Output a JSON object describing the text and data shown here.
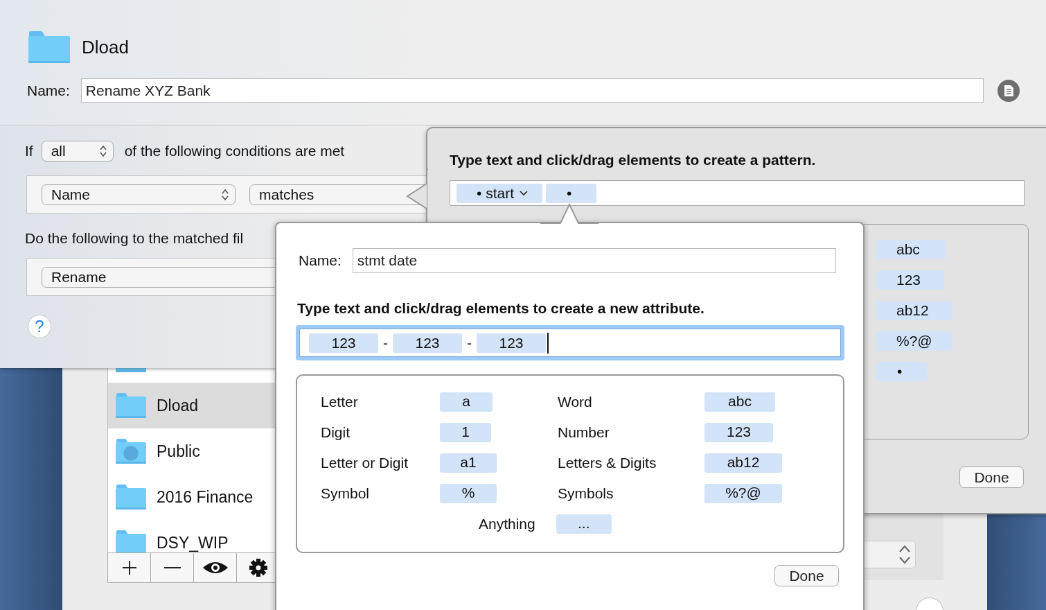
{
  "folder_list": {
    "items": [
      {
        "kind": "folder",
        "selected": false
      },
      {
        "kind": "folder",
        "name": "Dload",
        "selected": true
      },
      {
        "kind": "globe-folder",
        "name": "Public",
        "selected": false
      },
      {
        "kind": "folder",
        "name": "2016 Finance",
        "selected": false
      },
      {
        "kind": "folder",
        "name": "DSY_WIP",
        "selected": false
      }
    ]
  },
  "rule_sheet": {
    "folder_name": "Dload",
    "name_label": "Name:",
    "name_value": "Rename XYZ Bank",
    "if_label": "If",
    "match_popup": "all",
    "conditions_text": "of the following conditions are met",
    "condition": {
      "attribute": "Name",
      "operator": "matches"
    },
    "actions_label": "Do the following to the matched fil",
    "action": "Rename",
    "help": "?"
  },
  "pattern_popover": {
    "title": "Type text and click/drag elements to create a pattern.",
    "tokens": [
      {
        "kind": "menu",
        "label": "• start"
      },
      {
        "kind": "plain",
        "label": "•"
      }
    ],
    "elements": [
      "abc",
      "123",
      "ab12",
      "%?@",
      "•"
    ],
    "done": "Done"
  },
  "attribute_popover": {
    "name_label": "Name:",
    "name_value": "stmt date",
    "title": "Type text and click/drag elements to create a new attribute.",
    "focused": true,
    "tokens": [
      {
        "kind": "token",
        "text": "123"
      },
      {
        "kind": "literal",
        "text": "-"
      },
      {
        "kind": "token",
        "text": "123"
      },
      {
        "kind": "literal",
        "text": "-"
      },
      {
        "kind": "token",
        "text": "123"
      }
    ],
    "elements": [
      {
        "label": "Letter",
        "token": "a"
      },
      {
        "label": "Word",
        "token": "abc"
      },
      {
        "label": "Digit",
        "token": "1"
      },
      {
        "label": "Number",
        "token": "123"
      },
      {
        "label": "Letter or Digit",
        "token": "a1"
      },
      {
        "label": "Letters & Digits",
        "token": "ab12"
      },
      {
        "label": "Symbol",
        "token": "%"
      },
      {
        "label": "Symbols",
        "token": "%?@"
      }
    ],
    "anything": {
      "label": "Anything",
      "token": "..."
    },
    "done": "Done"
  }
}
